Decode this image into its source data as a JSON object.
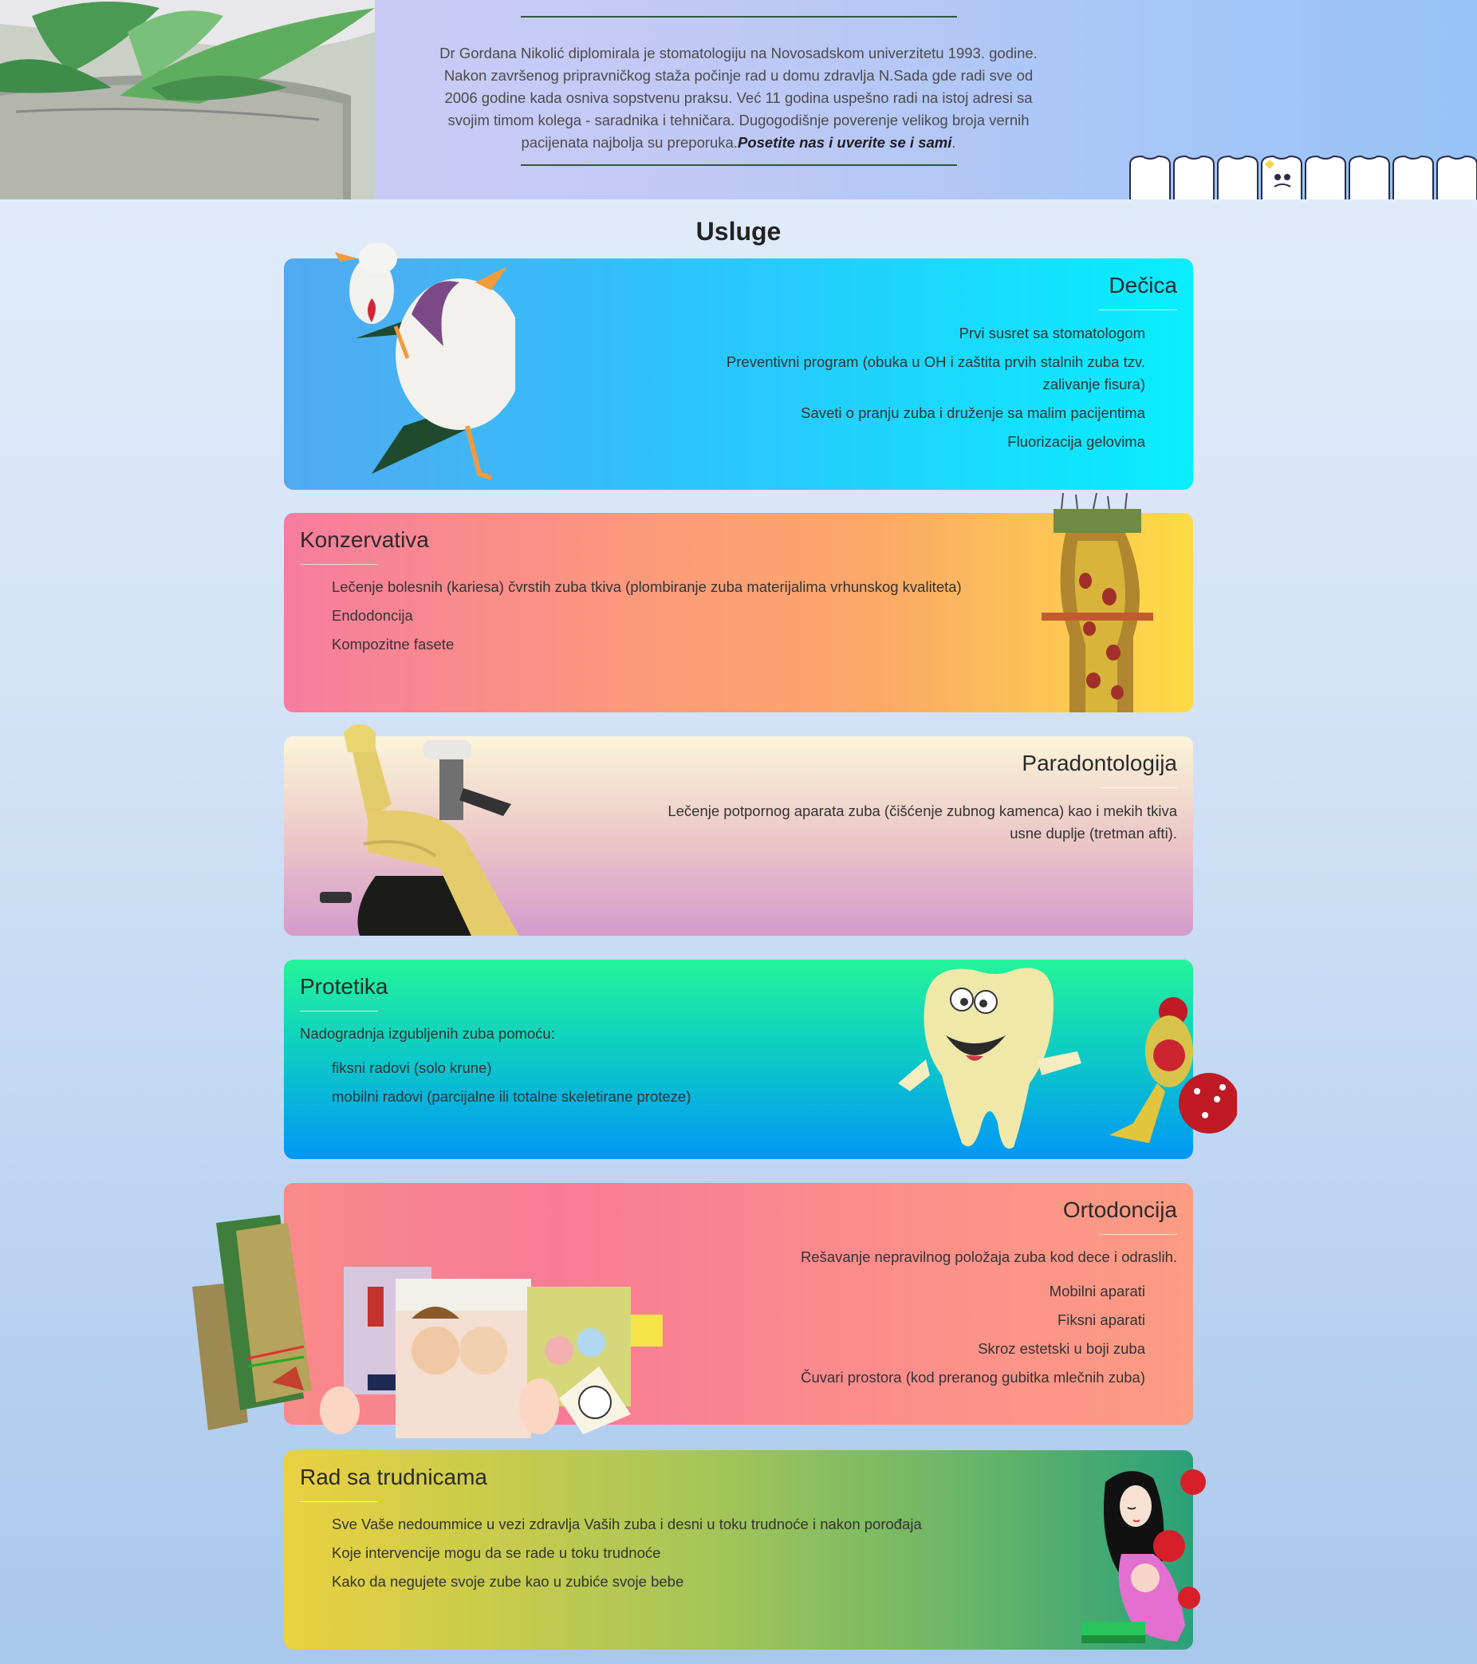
{
  "header": {
    "intro_text": "Dr Gordana Nikolić diplomirala je stomatologiju na Novosadskom univerzitetu 1993. godine. Nakon završenog pripravničkog staža počinje rad u domu zdravlja N.Sada gde radi sve od 2006 godine kada osniva sopstvenu praksu. Već 11 godina uspešno radi na istoj adresi sa svojim timom kolega - saradnika i tehničara. Dugogodišnje poverenje velikog broja vernih pacijenata najbolja su preporuka.",
    "intro_emphasis": "Posetite nas i uverite se i sami"
  },
  "services": {
    "title": "Usluge",
    "decica": {
      "title": "Dečica",
      "items": [
        "Prvi susret sa stomatologom",
        "Preventivni program (obuka u OH i zaštita prvih stalnih zuba tzv. zalivanje fisura)",
        "Saveti o pranju zuba i druženje sa malim pacijentima",
        "Fluorizacija gelovima"
      ]
    },
    "konzervativa": {
      "title": "Konzervativa",
      "items": [
        "Lečenje bolesnih (kariesa) čvrstih zuba tkiva (plombiranje zuba materijalima vrhunskog kvaliteta)",
        "Endodoncija",
        "Kompozitne fasete"
      ]
    },
    "paradontologija": {
      "title": "Paradontologija",
      "text": "Lečenje potpornog aparata zuba (čišćenje zubnog kamenca) kao i mekih tkiva usne duplje (tretman afti)."
    },
    "protetika": {
      "title": "Protetika",
      "intro": "Nadogradnja izgubljenih zuba pomoću:",
      "items": [
        "fiksni radovi (solo krune)",
        "mobilni radovi (parcijalne ili totalne skeletirane proteze)"
      ]
    },
    "ortodoncija": {
      "title": "Ortodoncija",
      "intro": "Rešavanje nepravilnog položaja zuba kod dece i odraslih.",
      "items": [
        "Mobilni aparati",
        "Fiksni aparati",
        "Skroz estetski u boji zuba",
        "Čuvari prostora (kod preranog gubitka mlečnih zuba)"
      ]
    },
    "trudnice": {
      "title": "Rad sa trudnicama",
      "items": [
        "Sve Vaše nedoummice u vezi zdravlja Vaših zuba i desni u toku trudnoće i nakon porođaja",
        "Koje intervencije mogu da se rade u toku trudnoće",
        "Kako da negujete svoje zube kao u zubiće svoje bebe"
      ]
    }
  }
}
